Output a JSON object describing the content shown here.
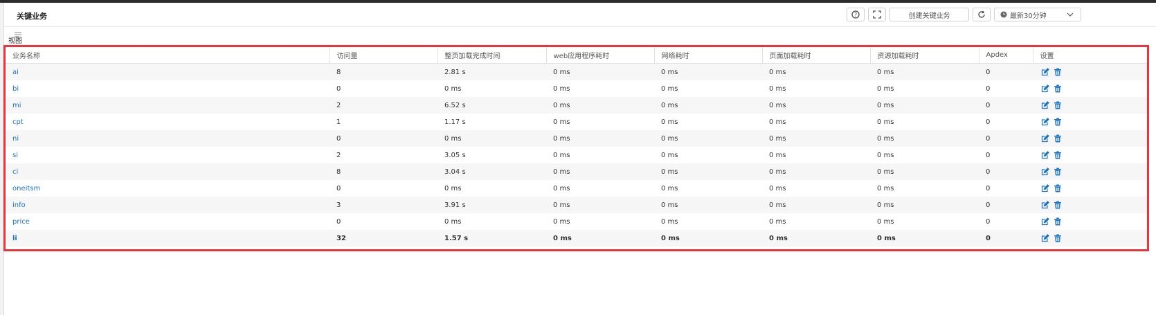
{
  "header": {
    "title": "关键业务",
    "help_icon": "help-icon",
    "fullscreen_icon": "fullscreen-icon",
    "create_label": "创建关键业务",
    "refresh_icon": "refresh-icon",
    "time_range_label": "最新30分钟",
    "clock_icon": "clock-icon",
    "chevron_icon": "chevron-down-icon"
  },
  "view": {
    "label": "视图",
    "icon": "menu-lines-icon"
  },
  "table": {
    "headers": [
      "业务名称",
      "访问量",
      "整页加载完成时间",
      "web应用程序耗时",
      "网络耗时",
      "页面加载耗时",
      "资源加载耗时",
      "Apdex",
      "设置"
    ],
    "rows": [
      {
        "name": "ai",
        "visits": "8",
        "page_load": "2.81 s",
        "web_app": "0 ms",
        "network": "0 ms",
        "page_render": "0 ms",
        "resource": "0 ms",
        "apdex": "0"
      },
      {
        "name": "bi",
        "visits": "0",
        "page_load": "0 ms",
        "web_app": "0 ms",
        "network": "0 ms",
        "page_render": "0 ms",
        "resource": "0 ms",
        "apdex": "0"
      },
      {
        "name": "mi",
        "visits": "2",
        "page_load": "6.52 s",
        "web_app": "0 ms",
        "network": "0 ms",
        "page_render": "0 ms",
        "resource": "0 ms",
        "apdex": "0"
      },
      {
        "name": "cpt",
        "visits": "1",
        "page_load": "1.17 s",
        "web_app": "0 ms",
        "network": "0 ms",
        "page_render": "0 ms",
        "resource": "0 ms",
        "apdex": "0"
      },
      {
        "name": "ni",
        "visits": "0",
        "page_load": "0 ms",
        "web_app": "0 ms",
        "network": "0 ms",
        "page_render": "0 ms",
        "resource": "0 ms",
        "apdex": "0"
      },
      {
        "name": "si",
        "visits": "2",
        "page_load": "3.05 s",
        "web_app": "0 ms",
        "network": "0 ms",
        "page_render": "0 ms",
        "resource": "0 ms",
        "apdex": "0"
      },
      {
        "name": "ci",
        "visits": "8",
        "page_load": "3.04 s",
        "web_app": "0 ms",
        "network": "0 ms",
        "page_render": "0 ms",
        "resource": "0 ms",
        "apdex": "0"
      },
      {
        "name": "oneitsm",
        "visits": "0",
        "page_load": "0 ms",
        "web_app": "0 ms",
        "network": "0 ms",
        "page_render": "0 ms",
        "resource": "0 ms",
        "apdex": "0"
      },
      {
        "name": "info",
        "visits": "3",
        "page_load": "3.91 s",
        "web_app": "0 ms",
        "network": "0 ms",
        "page_render": "0 ms",
        "resource": "0 ms",
        "apdex": "0"
      },
      {
        "name": "price",
        "visits": "0",
        "page_load": "0 ms",
        "web_app": "0 ms",
        "network": "0 ms",
        "page_render": "0 ms",
        "resource": "0 ms",
        "apdex": "0"
      },
      {
        "name": "li",
        "visits": "32",
        "page_load": "1.57 s",
        "web_app": "0 ms",
        "network": "0 ms",
        "page_render": "0 ms",
        "resource": "0 ms",
        "apdex": "0"
      }
    ],
    "edit_icon": "edit-icon",
    "delete_icon": "trash-icon"
  },
  "colors": {
    "highlight_border": "#e8343a",
    "link_blue": "#1a73c8",
    "row_stripe": "#f6f6f6"
  }
}
